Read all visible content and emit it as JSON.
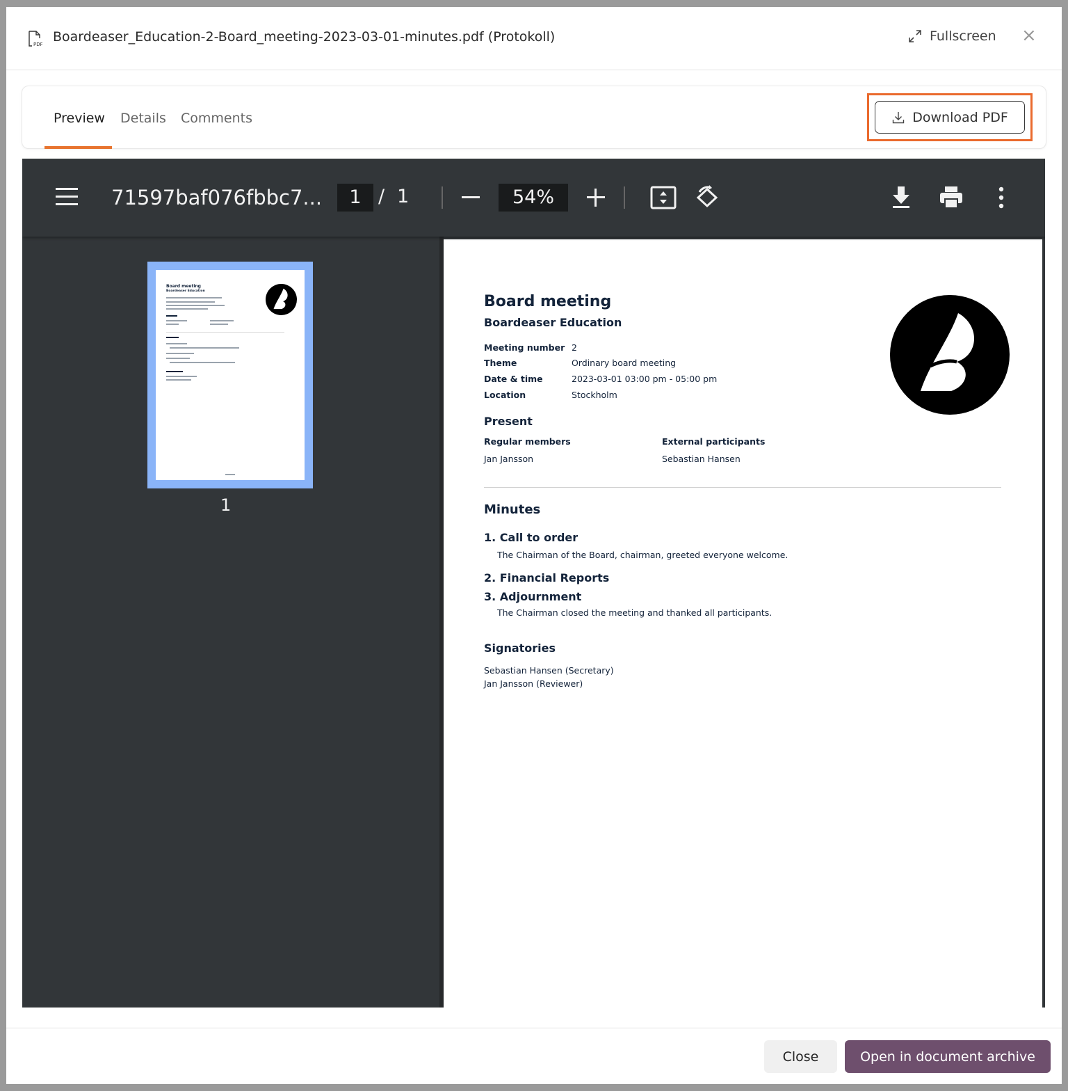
{
  "modal": {
    "title": "Boardeaser_Education-2-Board_meeting-2023-03-01-minutes.pdf (Protokoll)",
    "file_icon": "pdf-file-icon",
    "fullscreen_label": "Fullscreen",
    "close_symbol": "×"
  },
  "tabs": [
    {
      "label": "Preview",
      "active": true
    },
    {
      "label": "Details",
      "active": false
    },
    {
      "label": "Comments",
      "active": false
    }
  ],
  "download_button": {
    "label": "Download PDF",
    "icon": "download-icon"
  },
  "highlight_color": "#ea6a2d",
  "accent_color": "#e8742f",
  "viewer": {
    "doc_name": "71597baf076fbbc7...",
    "current_page": "1",
    "page_separator": "/",
    "total_pages": "1",
    "zoom": "54%",
    "thumbnail_label": "1"
  },
  "pdf": {
    "title": "Board meeting",
    "organization": "Boardeaser Education",
    "fields": [
      {
        "label": "Meeting number",
        "value": "2"
      },
      {
        "label": "Theme",
        "value": "Ordinary board meeting"
      },
      {
        "label": "Date & time",
        "value": "2023-03-01 03:00 pm - 05:00 pm"
      },
      {
        "label": "Location",
        "value": "Stockholm"
      }
    ],
    "present": {
      "heading": "Present",
      "regular_heading": "Regular members",
      "regular_value": "Jan Jansson",
      "external_heading": "External participants",
      "external_value": "Sebastian Hansen"
    },
    "minutes": {
      "heading": "Minutes",
      "items": [
        {
          "title": "1. Call to order",
          "text": "The Chairman of the Board, chairman, greeted everyone welcome."
        },
        {
          "title": "2. Financial Reports",
          "text": ""
        },
        {
          "title": "3. Adjournment",
          "text": "The Chairman closed the meeting and thanked all participants."
        }
      ]
    },
    "signatories": {
      "heading": "Signatories",
      "lines": [
        "Sebastian Hansen (Secretary)",
        "Jan Jansson (Reviewer)"
      ]
    }
  },
  "footer": {
    "close_label": "Close",
    "open_label": "Open in document archive",
    "open_color": "#6e4f6d"
  }
}
